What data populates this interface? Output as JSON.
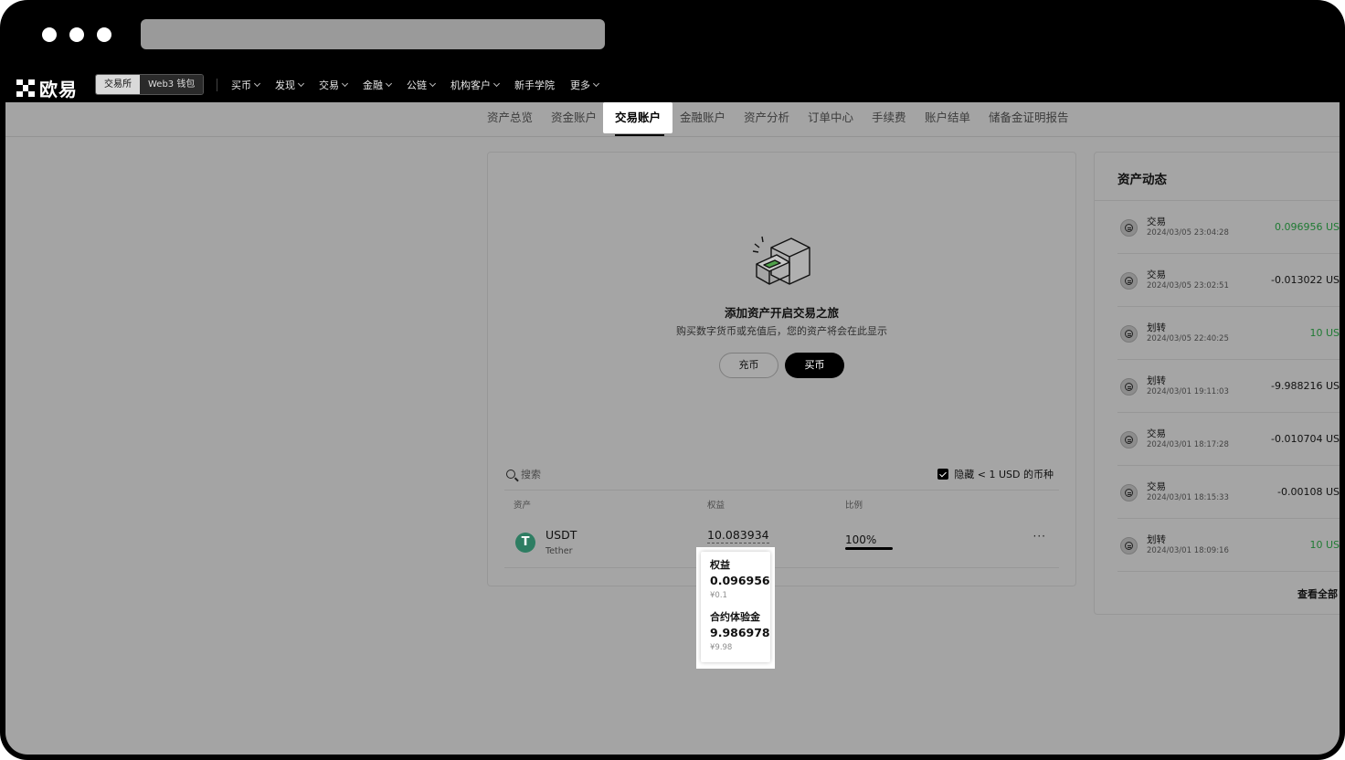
{
  "brand": {
    "logo_text": "欧易"
  },
  "nav": {
    "segments": {
      "exchange": "交易所",
      "wallet": "Web3 钱包"
    },
    "items": [
      "买币",
      "发现",
      "交易",
      "金融",
      "公链",
      "机构客户",
      "新手学院",
      "更多"
    ]
  },
  "tabs": [
    "资产总览",
    "资金账户",
    "交易账户",
    "金融账户",
    "资产分析",
    "订单中心",
    "手续费",
    "账户结单",
    "储备金证明报告"
  ],
  "active_tab": "交易账户",
  "empty_state": {
    "title": "添加资产开启交易之旅",
    "subtitle": "购买数字货币或充值后，您的资产将会在此显示",
    "deposit_label": "充币",
    "buy_label": "买币"
  },
  "asset_table": {
    "search_placeholder": "搜索",
    "hide_small_label": "隐藏 < 1 USD 的币种",
    "hide_small_checked": true,
    "columns": [
      "资产",
      "权益",
      "比例"
    ],
    "rows": [
      {
        "symbol": "USDT",
        "name": "Tether",
        "icon_letter": "T",
        "equity": "10.083934",
        "ratio": "100%",
        "ratio_value": 1.0,
        "more": "···"
      }
    ]
  },
  "tooltip": {
    "equity_label": "权益",
    "equity_value": "0.096956",
    "equity_fiat": "¥0.1",
    "bonus_label": "合约体验金",
    "bonus_value": "9.986978",
    "bonus_fiat": "¥9.98"
  },
  "activity": {
    "title": "资产动态",
    "items": [
      {
        "type": "交易",
        "time": "2024/03/05 23:04:28",
        "amount": "0.096956 US",
        "positive": true
      },
      {
        "type": "交易",
        "time": "2024/03/05 23:02:51",
        "amount": "-0.013022 US",
        "positive": false
      },
      {
        "type": "划转",
        "time": "2024/03/05 22:40:25",
        "amount": "10 US",
        "positive": true
      },
      {
        "type": "划转",
        "time": "2024/03/01 19:11:03",
        "amount": "-9.988216 US",
        "positive": false
      },
      {
        "type": "交易",
        "time": "2024/03/01 18:17:28",
        "amount": "-0.010704 US",
        "positive": false
      },
      {
        "type": "交易",
        "time": "2024/03/01 18:15:33",
        "amount": "-0.00108 US",
        "positive": false
      },
      {
        "type": "划转",
        "time": "2024/03/01 18:09:16",
        "amount": "10 US",
        "positive": true
      }
    ],
    "view_all": "查看全部"
  },
  "colors": {
    "positive": "#1f7a33",
    "usdt": "#2e7d62"
  }
}
